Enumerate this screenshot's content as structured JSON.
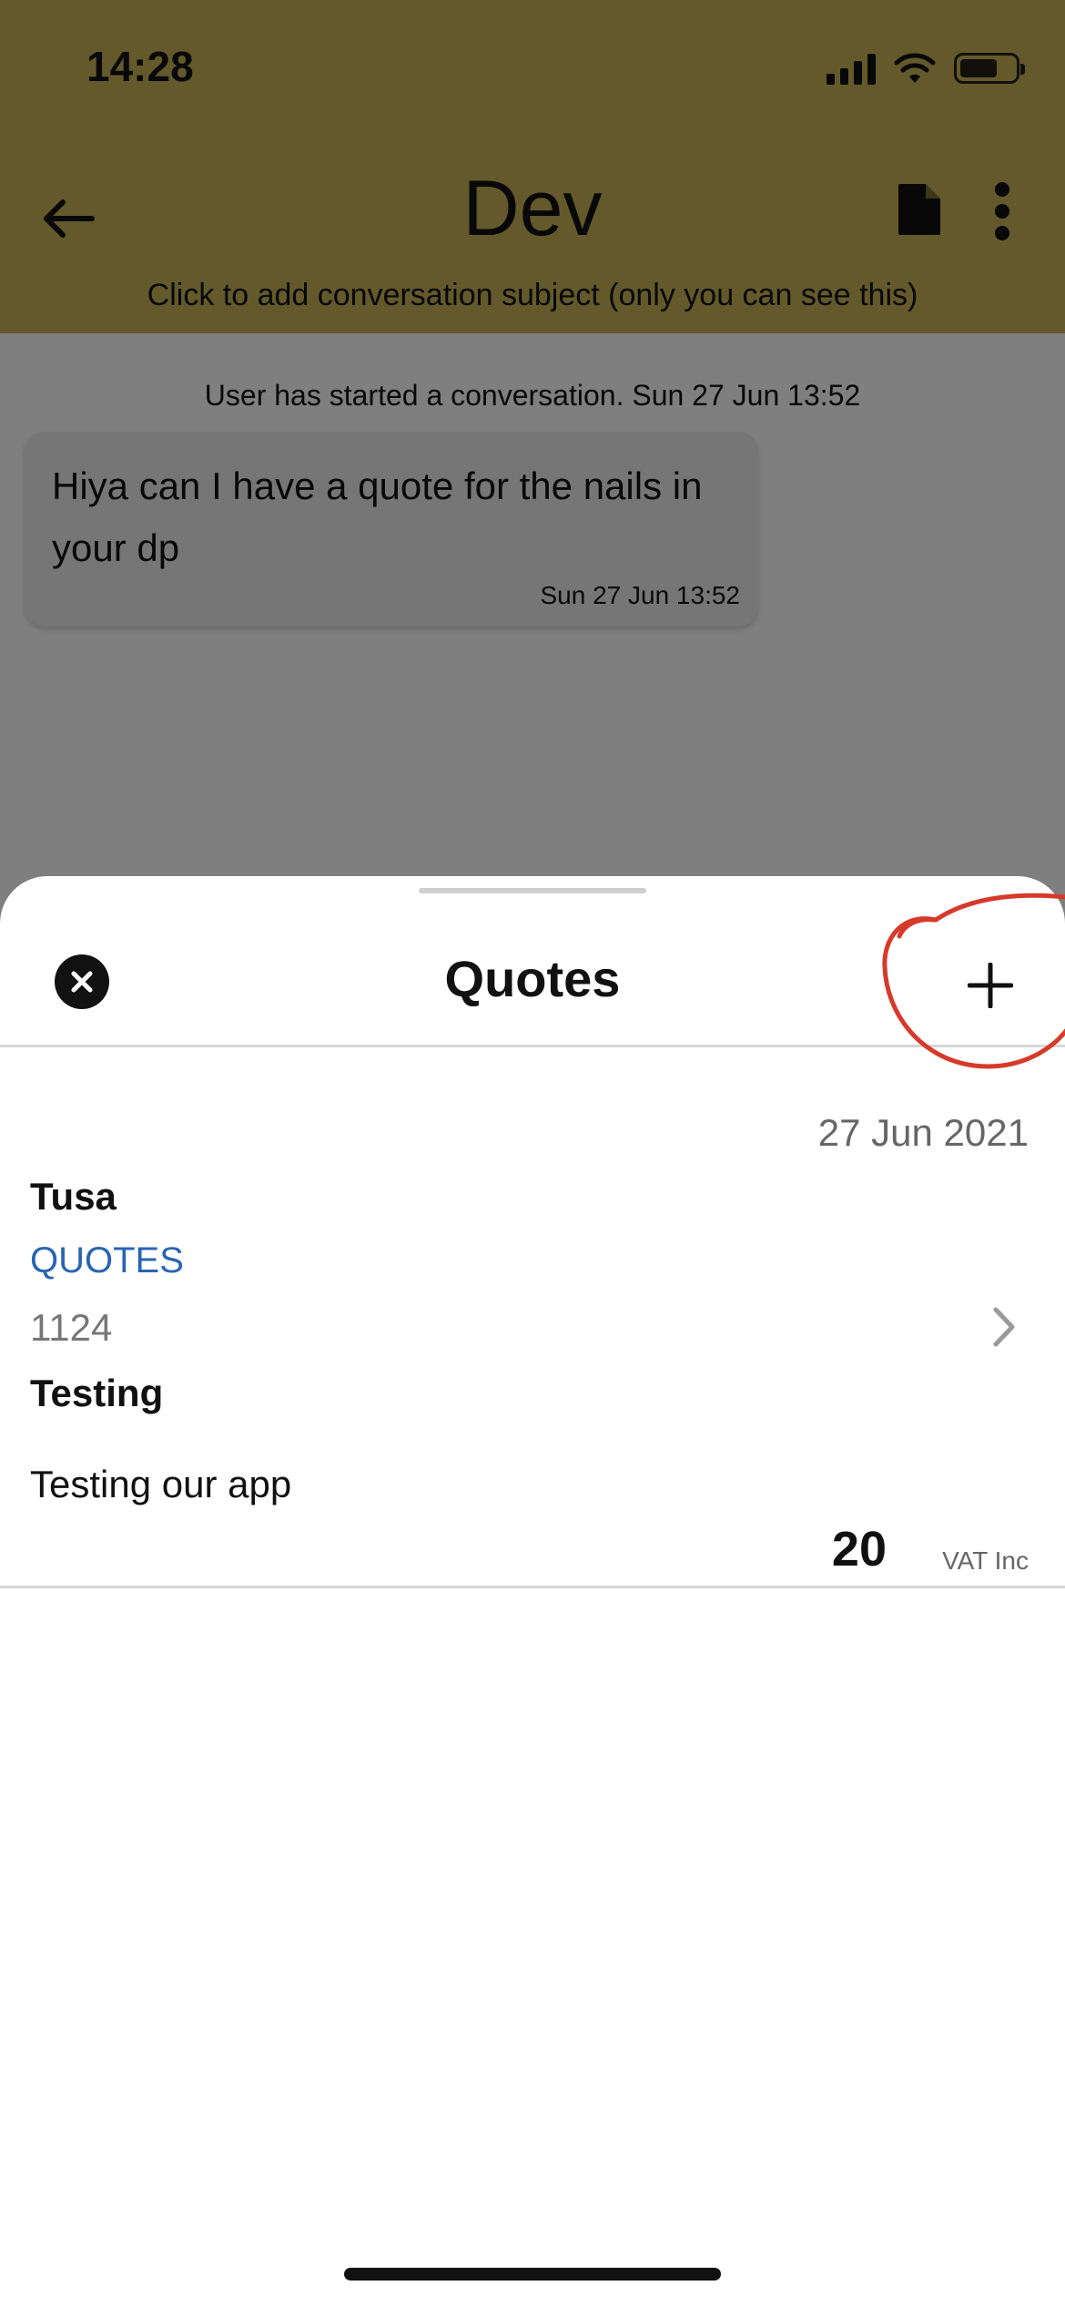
{
  "status_bar": {
    "time": "14:28"
  },
  "header": {
    "title": "Dev",
    "subject_hint": "Click to add conversation subject (only you can see this)",
    "back_icon": "arrow-left-icon",
    "document_icon": "document-icon",
    "more_icon": "more-vertical-icon"
  },
  "chat": {
    "system_message": "User has started a conversation. Sun 27 Jun 13:52",
    "messages": [
      {
        "text": "Hiya can I have a quote for the nails in your dp",
        "time": "Sun 27 Jun 13:52"
      }
    ]
  },
  "sheet": {
    "title": "Quotes",
    "close_icon": "close-circle-icon",
    "add_icon": "plus-icon",
    "quotes": [
      {
        "date": "27 Jun 2021",
        "customer": "Tusa",
        "type": "QUOTES",
        "number": "1124",
        "subject": "Testing",
        "description": "Testing our app",
        "amount": "20",
        "vat": "VAT Inc"
      }
    ]
  },
  "colors": {
    "header_bg": "#c7b257",
    "link_blue": "#2a64b2",
    "annotation_red": "#d63a2a"
  }
}
